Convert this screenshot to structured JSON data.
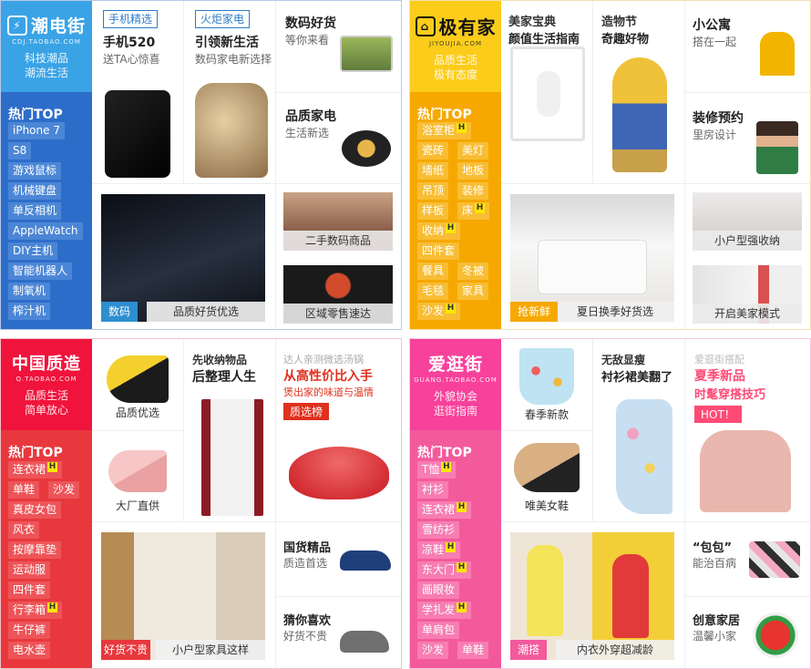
{
  "s1": {
    "brand": "潮电街",
    "brand_sub": "CDJ.TAOBAO.COM",
    "slogan1": "科技潮品",
    "slogan2": "潮流生活",
    "hot_title": "热门TOP",
    "tags": [
      "iPhone 7",
      "S8",
      "游戏鼠标",
      "机械键盘",
      "单反相机",
      "AppleWatch",
      "DIY主机",
      "智能机器人",
      "制氧机",
      "榨汁机"
    ],
    "c1": {
      "badge": "手机精选",
      "title": "手机520",
      "sub": "送TA心惊喜"
    },
    "c2": {
      "badge": "火炬家电",
      "title": "引领新生活",
      "sub": "数码家电新选择"
    },
    "c3": {
      "title": "数码好货",
      "sub": "等你来看"
    },
    "c4": {
      "title": "品质家电",
      "sub": "生活新选"
    },
    "big": {
      "label": "数码",
      "caption": "品质好货优选"
    },
    "small1": {
      "caption": "二手数码商品"
    },
    "small2": {
      "caption": "区域零售速达"
    }
  },
  "s2": {
    "brand": "极有家",
    "brand_sub": "JIYOUJIA.COM",
    "slogan1": "品质生活",
    "slogan2": "极有态度",
    "hot_title": "热门TOP",
    "tags": [
      "浴室柜",
      "瓷砖",
      "美灯",
      "墙纸",
      "地板",
      "吊顶",
      "装修",
      "样板",
      "床",
      "收纳",
      "四件套",
      "餐具",
      "冬被",
      "毛毯",
      "家具",
      "沙发"
    ],
    "c1": {
      "title": "美家宝典",
      "sub": "颜值生活指南"
    },
    "c2": {
      "title": "造物节",
      "sub": "奇趣好物"
    },
    "c3": {
      "title": "小公寓",
      "sub": "搭在一起"
    },
    "c4": {
      "title": "装修预约",
      "sub": "里房设计"
    },
    "big": {
      "label": "抢新鲜",
      "caption": "夏日换季好货选"
    },
    "small1": {
      "caption": "小户型强收纳"
    },
    "small2": {
      "caption": "开启美家模式"
    }
  },
  "s3": {
    "brand": "中国质造",
    "brand_sub": "Q.TAOBAO.COM",
    "slogan1": "品质生活",
    "slogan2": "简单放心",
    "hot_title": "热门TOP",
    "tags": [
      "连衣裙",
      "单鞋",
      "沙发",
      "真皮女包",
      "风衣",
      "按摩靠垫",
      "运动服",
      "四件套",
      "行李箱",
      "牛仔裤",
      "电水壶"
    ],
    "c1": {
      "caption": "品质优选"
    },
    "c2": {
      "caption": "大厂直供"
    },
    "c3": {
      "title": "先收纳物品",
      "sub": "后整理人生"
    },
    "promo": {
      "top": "达人亲测微选汤锅",
      "line1": "从高性价比入手",
      "line2": "煲出家的味道与温情",
      "btn": "质选榜"
    },
    "c4": {
      "title": "国货精品",
      "sub": "质造首选"
    },
    "c5": {
      "title": "猜你喜欢",
      "sub": "好货不贵"
    },
    "big": {
      "label": "好货不贵",
      "caption": "小户型家具这样"
    }
  },
  "s4": {
    "brand": "爱逛街",
    "brand_sub": "GUANG.TAOBAO.COM",
    "slogan1": "外貌协会",
    "slogan2": "逛街指南",
    "hot_title": "热门TOP",
    "tags": [
      "T恤",
      "衬衫",
      "连衣裙",
      "雪纺衫",
      "凉鞋",
      "东大门",
      "画眼妆",
      "学扎发",
      "单肩包",
      "沙发",
      "单鞋"
    ],
    "c1": {
      "caption": "春季新款"
    },
    "c2": {
      "caption": "唯美女鞋"
    },
    "c3": {
      "title": "无敌显瘦",
      "sub": "衬衫裙美翻了"
    },
    "promo": {
      "top": "爱逛街搭配",
      "line1": "夏季新品",
      "line2": "时髦穿搭技巧",
      "btn": "HOT！"
    },
    "c4": {
      "title": "“包包”",
      "sub": "能治百病"
    },
    "c5": {
      "title": "创意家居",
      "sub": "温馨小家"
    },
    "big": {
      "label": "潮搭",
      "caption": "内衣外穿超减龄"
    }
  },
  "colors": {
    "blue": "#2d6dca",
    "orange": "#f6a800",
    "red": "#e8383d",
    "pink": "#f35a9c"
  }
}
